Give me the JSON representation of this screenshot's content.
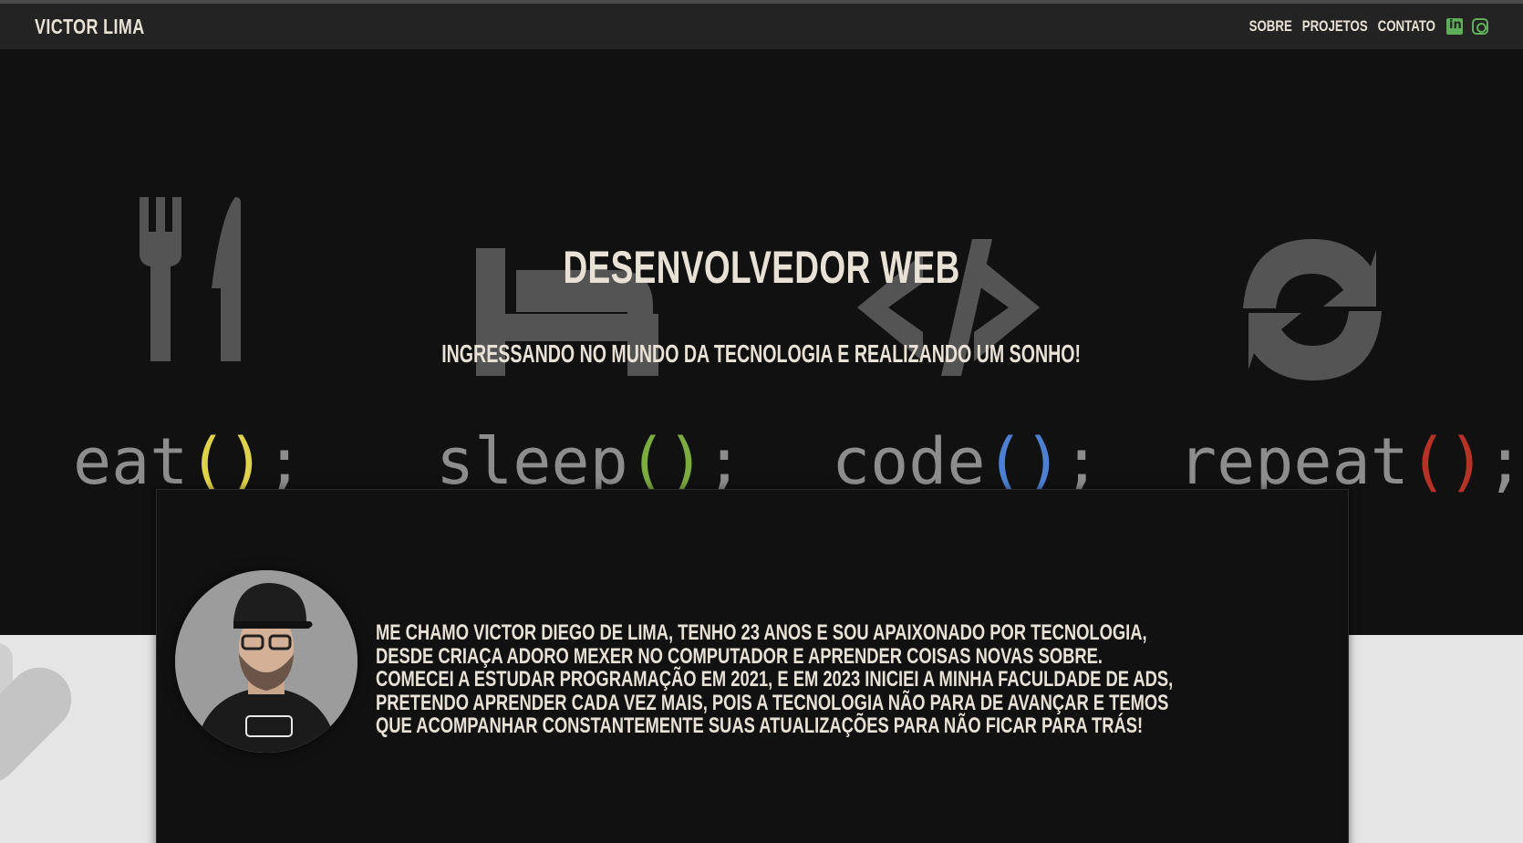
{
  "nav": {
    "brand": "VICTOR LIMA",
    "links": [
      "SOBRE",
      "PROJETOS",
      "CONTATO"
    ],
    "social_icons": [
      "linkedin-icon",
      "instagram-icon"
    ],
    "accent_color": "#5fae5a"
  },
  "hero": {
    "title": "DESENVOLVEDOR WEB",
    "subtitle": "INGRESSANDO NO MUNDO DA TECNOLOGIA E REALIZANDO UM SONHO!",
    "background_words": [
      {
        "word": "eat",
        "open": "(",
        "close": ")",
        "end": ";",
        "paren_color": "#e0d24a",
        "icon": "fork-knife-icon"
      },
      {
        "word": "sleep",
        "open": "(",
        "close": ")",
        "end": ";",
        "paren_color": "#7cab3f",
        "icon": "bed-icon"
      },
      {
        "word": "code",
        "open": "(",
        "close": ")",
        "end": ";",
        "paren_color": "#4d7fd3",
        "icon": "code-icon"
      },
      {
        "word": "repeat",
        "open": "(",
        "close": ")",
        "end": ";",
        "paren_color": "#b73226",
        "icon": "repeat-icon"
      }
    ]
  },
  "about": {
    "text": "ME CHAMO VICTOR DIEGO DE LIMA, TENHO 23 ANOS E SOU APAIXONADO POR TECNOLOGIA, DESDE CRIAÇA ADORO MEXER NO COMPUTADOR E APRENDER COISAS NOVAS SOBRE. COMECEI A ESTUDAR PROGRAMAÇÃO EM 2021, E EM 2023 INICIEI A MINHA FACULDADE DE ADS, PRETENDO APRENDER CADA VEZ MAIS, POIS A TECNOLOGIA NÃO PARA DE AVANÇAR E TEMOS QUE ACOMPANHAR CONSTANTEMENTE SUAS ATUALIZAÇÕES PARA NÃO FICAR PARA TRÁS!"
  }
}
